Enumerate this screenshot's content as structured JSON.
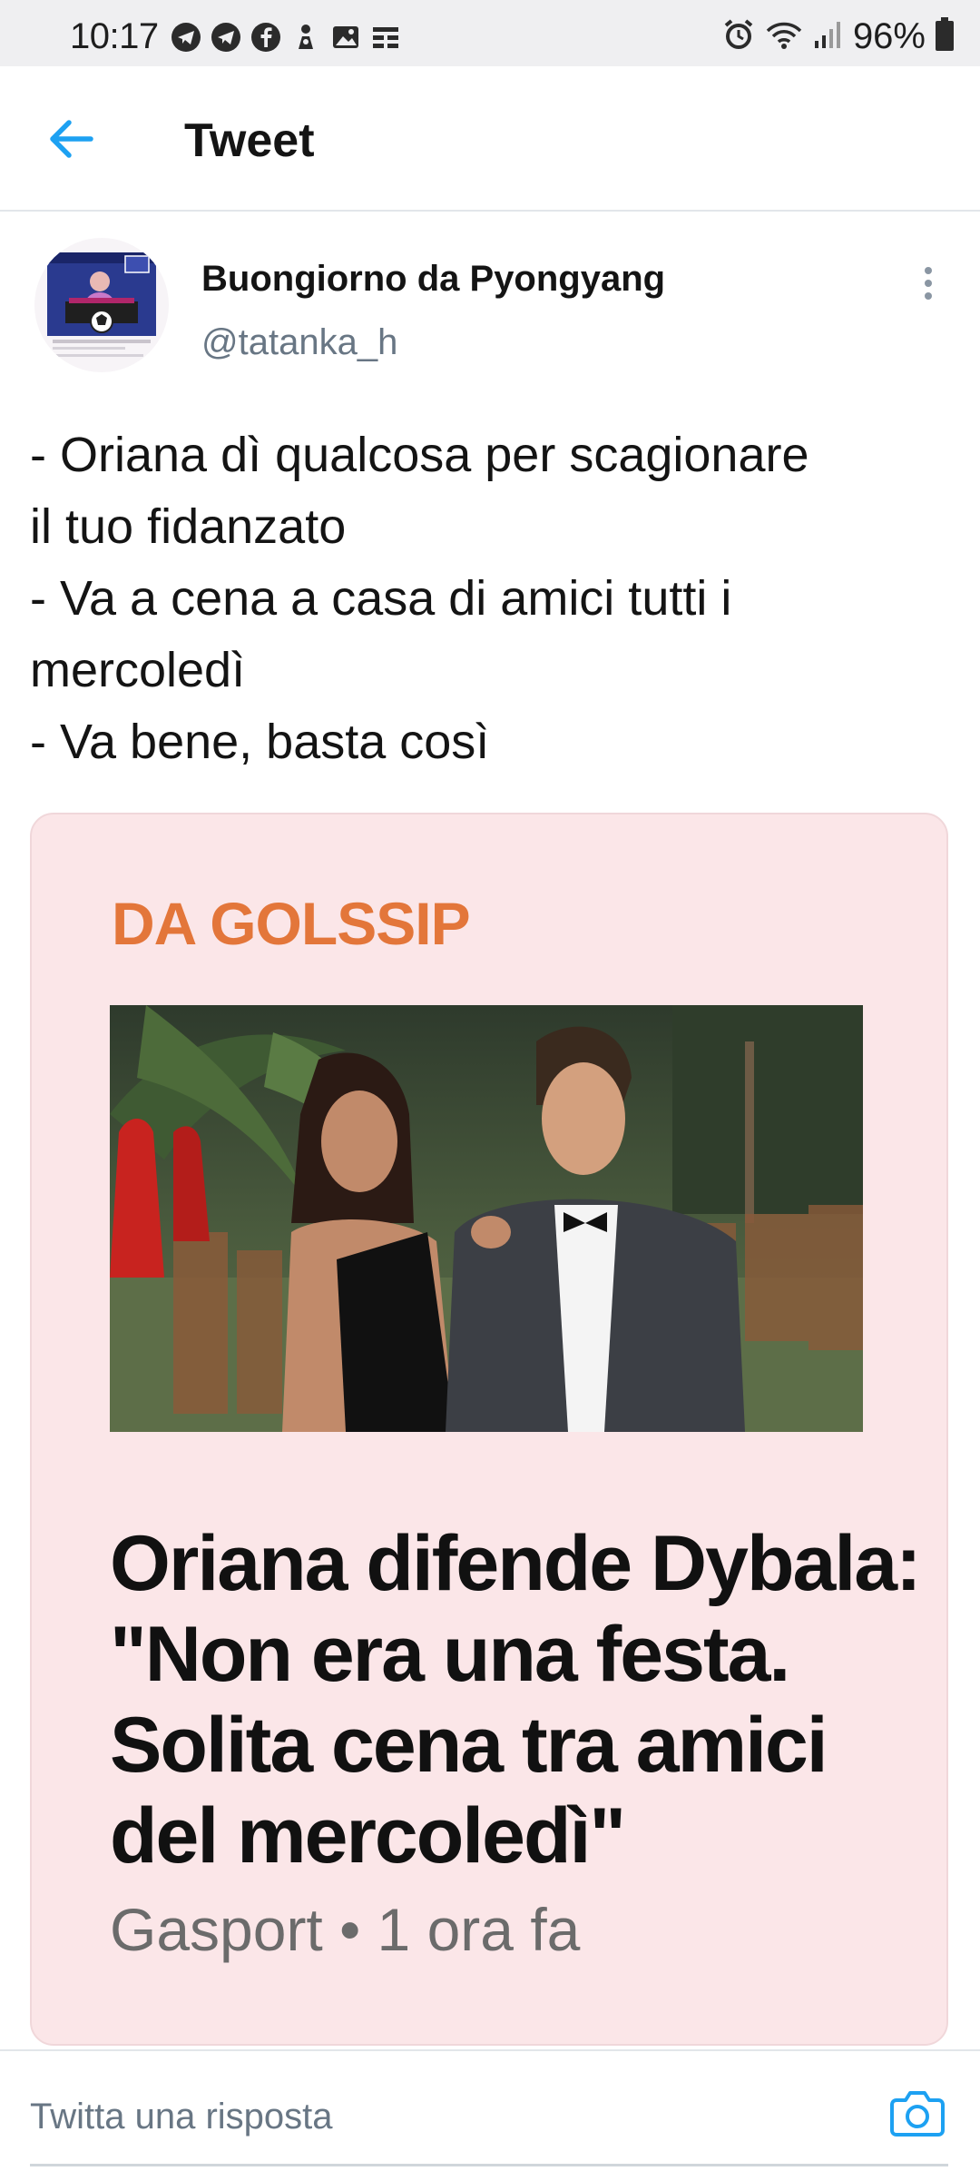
{
  "status_bar": {
    "time": "10:17",
    "notification_icons": [
      "telegram-icon",
      "telegram-icon",
      "facebook-icon",
      "figure-icon",
      "image-icon",
      "list-icon"
    ],
    "right_icons": [
      "alarm-icon",
      "wifi-icon",
      "signal-icon"
    ],
    "battery_percent": "96%",
    "battery_level": 0.96
  },
  "header": {
    "back_icon": "arrow-left-icon",
    "title": "Tweet",
    "accent_color": "#1da1f2"
  },
  "tweet": {
    "author_name": "Buongiorno da Pyongyang",
    "author_handle": "@tatanka_h",
    "text_lines": [
      "- Oriana dì qualcosa per scagionare",
      "il tuo fidanzato",
      "- Va a cena a casa di amici tutti i",
      "mercoledì",
      "- Va bene, basta così"
    ],
    "card": {
      "source": "DA GOLSSIP",
      "headline_lines": [
        "Oriana difende Dybala:",
        "\"Non era una festa.",
        "Solita cena tra amici",
        "del mercoledì\""
      ],
      "meta": "Gasport • 1 ora fa",
      "source_color": "#e3763a",
      "background_color": "#fbe6e8"
    }
  },
  "reply_bar": {
    "placeholder": "Twitta una risposta",
    "camera_icon": "camera-icon"
  }
}
